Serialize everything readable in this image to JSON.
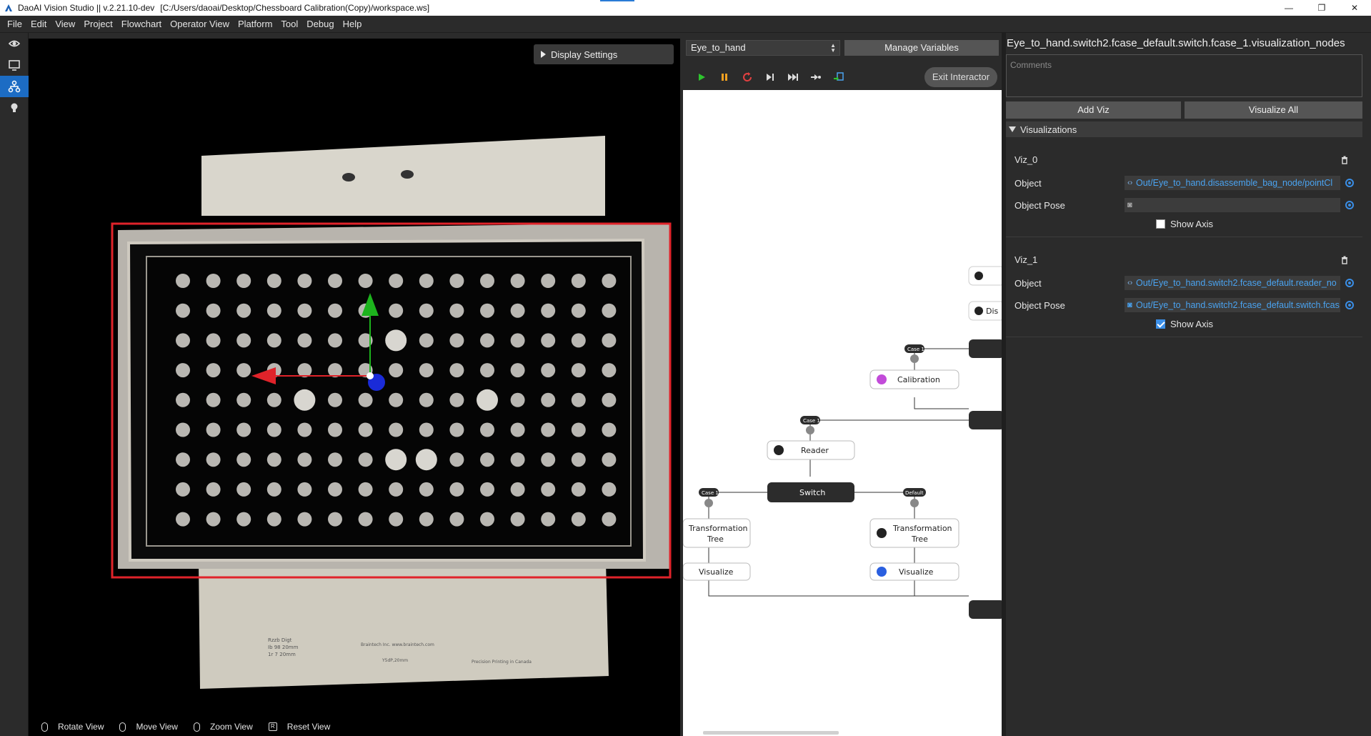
{
  "window": {
    "title": "DaoAI Vision Studio || v.2.21.10-dev",
    "path": "[C:/Users/daoai/Desktop/Chessboard Calibration(Copy)/workspace.ws]",
    "minimize": "—",
    "restore": "❐",
    "close": "✕"
  },
  "menu": [
    "File",
    "Edit",
    "View",
    "Project",
    "Flowchart",
    "Operator View",
    "Platform",
    "Tool",
    "Debug",
    "Help"
  ],
  "left_tools": [
    "vision-icon",
    "monitor-icon",
    "flowchart-icon",
    "lightbulb-icon"
  ],
  "viewport": {
    "display_settings": "Display Settings",
    "hints": {
      "rotate": "Rotate View",
      "move": "Move View",
      "zoom": "Zoom View",
      "reset": "Reset View"
    },
    "board_label_rows": [
      "Rzzb  Digt",
      "Ib  98  20mm",
      "1r  7  20mm"
    ],
    "board_label_mid": [
      "Braintech Inc.  www.braintech.com",
      "Y5dP,20mm"
    ],
    "board_label_right": "Precision Printing in Canada",
    "accent_red": "#e0232a",
    "axis_green": "#1db31d",
    "axis_blue": "#1a2bd8"
  },
  "flow": {
    "selected_flow": "Eye_to_hand",
    "manage_variables": "Manage Variables",
    "exit_interactor": "Exit Interactor",
    "nodes": {
      "calibration": "Calibration",
      "reader": "Reader",
      "switch": "Switch",
      "tt_left_1": "Transformation",
      "tt_left_2": "Tree",
      "tt_right_1": "Transformation",
      "tt_right_2": "Tree",
      "viz_left": "Visualize",
      "viz_right": "Visualize",
      "dis_partial": "Dis"
    },
    "tags": {
      "case1_a": "Case 1",
      "case1_b": "Case 1",
      "case1_c": "Case 1",
      "default": "Default"
    }
  },
  "props": {
    "path": "Eye_to_hand.switch2.fcase_default.switch.fcase_1.visualization_nodes",
    "comments_placeholder": "Comments",
    "add_viz": "Add Viz",
    "visualize_all": "Visualize All",
    "visualizations_header": "Visualizations",
    "viz": [
      {
        "name": "Viz_0",
        "object_label": "Object",
        "object_value": "Out/Eye_to_hand.disassemble_bag_node/pointCl",
        "pose_label": "Object Pose",
        "pose_value": "",
        "show_axis": "Show Axis",
        "show_axis_checked": false
      },
      {
        "name": "Viz_1",
        "object_label": "Object",
        "object_value": "Out/Eye_to_hand.switch2.fcase_default.reader_no",
        "pose_label": "Object Pose",
        "pose_value": "Out/Eye_to_hand.switch2.fcase_default.switch.fcas",
        "show_axis": "Show Axis",
        "show_axis_checked": true
      }
    ]
  }
}
